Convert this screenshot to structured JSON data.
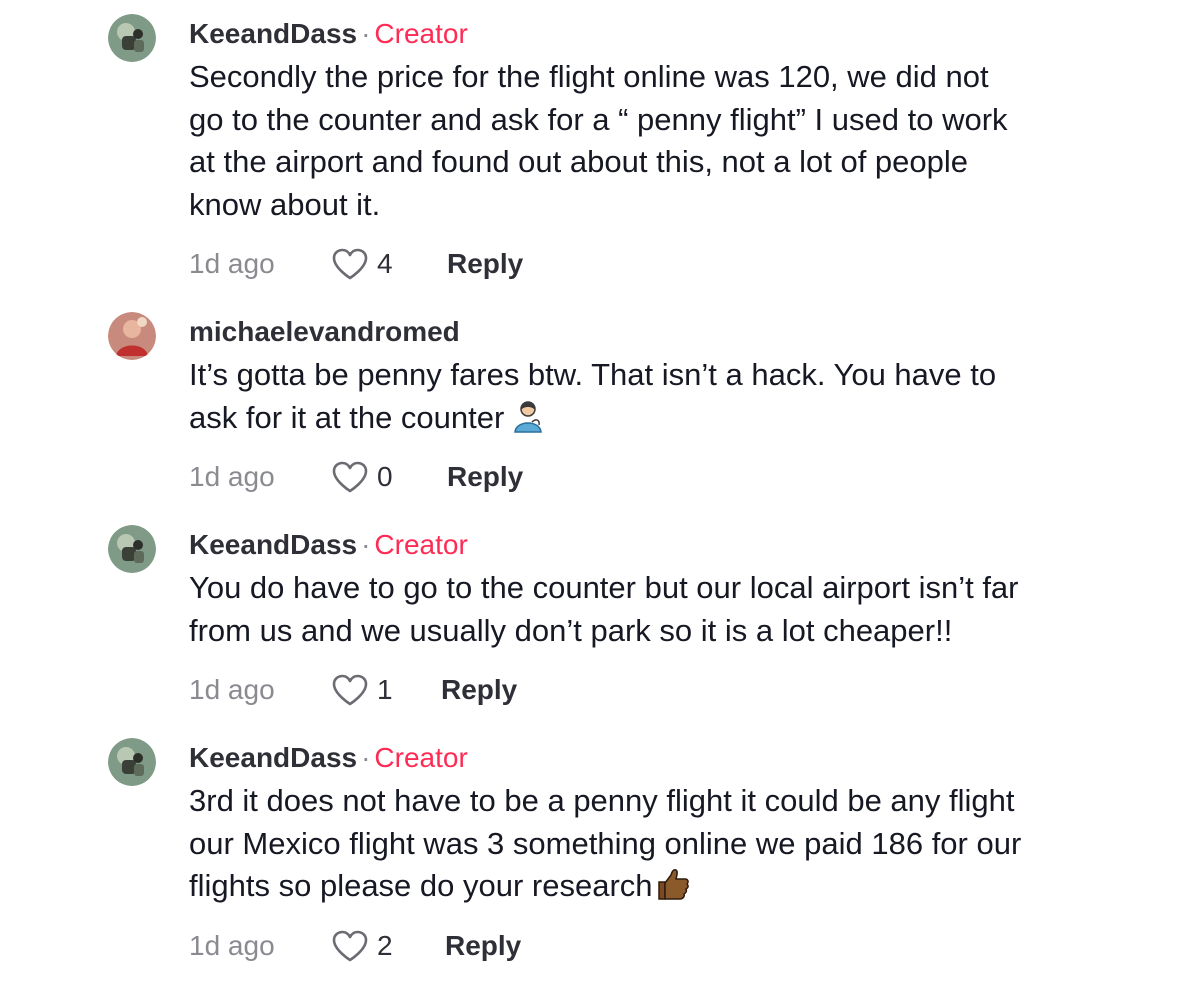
{
  "comments": [
    {
      "username": "KeeandDass",
      "separator": "·",
      "badge": "Creator",
      "text": "Secondly the price for the flight online was 120, we did not\ngo to the counter and ask for a “ penny flight” I used to work\nat the airport and found out about this, not a lot of people\nknow about it.",
      "timestamp": "1d ago",
      "likes": "4",
      "reply_label": "Reply"
    },
    {
      "username": "michaelevandromed",
      "text": "It’s gotta be penny fares btw. That isn’t a hack. You have to\nask for it at the counter",
      "emoji": "person-tipping-hand-emoji",
      "timestamp": "1d ago",
      "likes": "0",
      "reply_label": "Reply"
    },
    {
      "username": "KeeandDass",
      "separator": "·",
      "badge": "Creator",
      "text": "You do have to go to the counter but our local airport isn’t far\nfrom us and we usually don’t park so it is a lot cheaper!!",
      "timestamp": "1d ago",
      "likes": "1",
      "reply_label": "Reply"
    },
    {
      "username": "KeeandDass",
      "separator": "·",
      "badge": "Creator",
      "text": "3rd it does not have to be a penny flight it could be any flight\nour Mexico flight was 3 something online we paid 186 for our\nflights so please do your research",
      "emoji": "thumbs-up-emoji",
      "timestamp": "1d ago",
      "likes": "2",
      "reply_label": "Reply"
    }
  ],
  "colors": {
    "creator_badge": "#fe2c55",
    "muted_text": "#8a8b91",
    "primary_text": "#161823"
  }
}
